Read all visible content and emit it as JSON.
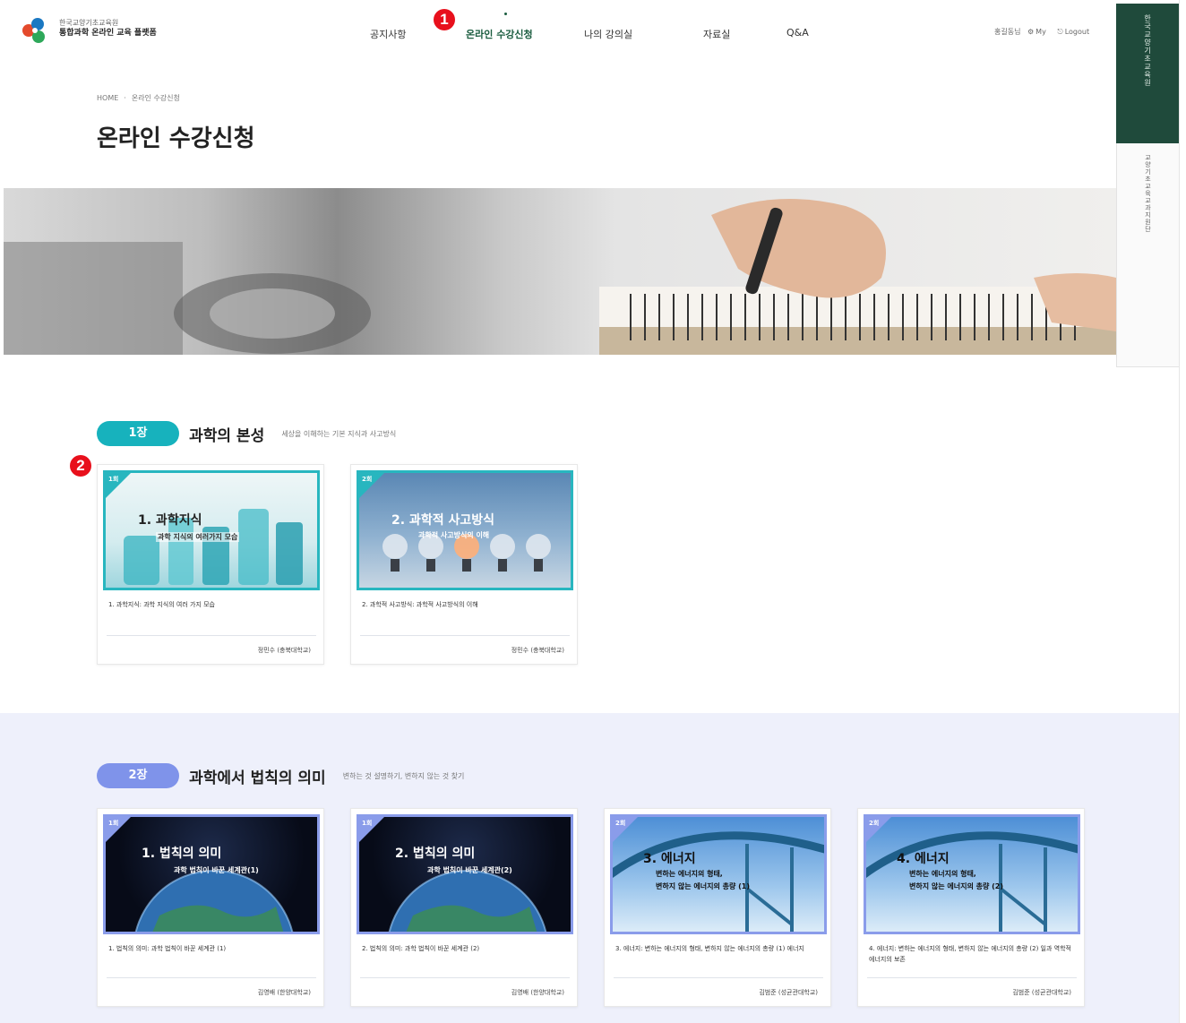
{
  "header": {
    "org_name": "한국교양기초교육원",
    "platform_name": "통합과학 온라인 교육 플랫폼",
    "nav": [
      {
        "label": "공지사항"
      },
      {
        "label": "온라인 수강신청"
      },
      {
        "label": "나의 강의실"
      },
      {
        "label": "자료실"
      },
      {
        "label": "Q&A"
      }
    ],
    "user_name": "홍길동님",
    "my_link": "My",
    "logout_link": "Logout"
  },
  "markers": {
    "one": "1",
    "two": "2"
  },
  "side_tabs": {
    "top": "한국교양기초교육원",
    "bottom": "교양기초교육교과지원단"
  },
  "breadcrumb": {
    "home": "HOME",
    "current": "온라인 수강신청"
  },
  "page_title": "온라인 수강신청",
  "chapters": [
    {
      "pill": "1장",
      "title": "과학의 본성",
      "subtitle": "세상을 이해하는 기본 지식과 사고방식",
      "cards": [
        {
          "badge": "1회",
          "thumb_title": "1. 과학지식",
          "thumb_sub": "과학 지식의 여러가지 모습",
          "desc": "1. 과학지식: 과학 지식의 여러 가지 모습",
          "author": "정민수 (충북대학교)"
        },
        {
          "badge": "2회",
          "thumb_title": "2. 과학적 사고방식",
          "thumb_sub": "과학적 사고방식의 이해",
          "desc": "2. 과학적 사고방식: 과학적 사고방식의 이해",
          "author": "정민수 (충북대학교)"
        }
      ]
    },
    {
      "pill": "2장",
      "title": "과학에서 법칙의 의미",
      "subtitle": "변하는 것 설명하기, 변하지 않는 것 찾기",
      "cards": [
        {
          "badge": "1회",
          "thumb_title": "1. 법칙의 의미",
          "thumb_sub": "과학 법칙이 바꾼 세계관(1)",
          "desc": "1. 법칙의 의미: 과학 법칙이 바꾼 세계관 (1)",
          "author": "김영배 (한양대학교)"
        },
        {
          "badge": "1회",
          "thumb_title": "2. 법칙의 의미",
          "thumb_sub": "과학 법칙이 바꾼 세계관(2)",
          "desc": "2. 법칙의 의미: 과학 법칙이 바꾼 세계관 (2)",
          "author": "김영배 (한양대학교)"
        },
        {
          "badge": "2회",
          "thumb_title": "3. 에너지",
          "thumb_sub": "변하는 에너지의 형태,",
          "thumb_sub2": "변하지 않는 에너지의 총량 (1)",
          "desc": "3. 에너지: 변하는 에너지의 형태, 변하지 않는 에너지의 총량 (1) 에너지",
          "author": "김범준 (성균관대학교)"
        },
        {
          "badge": "2회",
          "thumb_title": "4. 에너지",
          "thumb_sub": "변하는 에너지의 형태,",
          "thumb_sub2": "변하지 않는 에너지의 총량 (2)",
          "desc": "4. 에너지: 변하는 에너지의 형태, 변하지 않는 에너지의 총량 (2) 일과 역학적 에너지의 보존",
          "author": "김범준 (성균관대학교)"
        }
      ]
    }
  ],
  "colors": {
    "brand_green": "#1f4a3b",
    "chapter1_teal": "#17b2bd",
    "chapter2_blue": "#7f93ea",
    "marker_red": "#e8101c"
  }
}
